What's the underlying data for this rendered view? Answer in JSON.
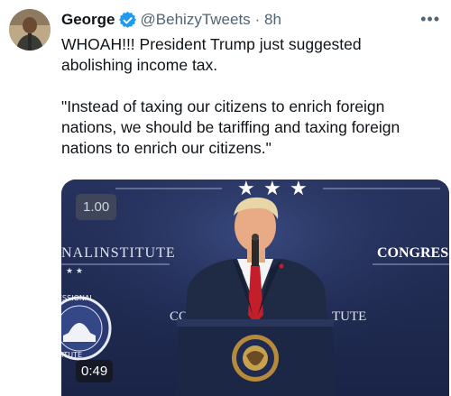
{
  "tweet": {
    "author_name": "George",
    "handle": "@BehizyTweets",
    "time": "· 8h",
    "text": "WHOAH!!! President Trump just suggested\nabolishing income tax.\n\n\"Instead of taxing our citizens to enrich foreign\nnations, we should be tariffing and taxing foreign\nnations to enrich our citizens.\"",
    "more_icon": "more-icon"
  },
  "video": {
    "speed_label": "1.00",
    "duration": "0:49",
    "backdrop_left_text": "NALINSTITUTE",
    "backdrop_right_text": "CONGRES",
    "backdrop_mid_left": "CO",
    "backdrop_mid_right": "TUTE",
    "seal_text": "ESSIONAL",
    "seal_text2": "ITUTE",
    "podium_seal_text": "SEAL OF THE PRESIDENT"
  },
  "colors": {
    "verified_blue": "#1d9bf0",
    "video_backdrop": "#1e2a52"
  }
}
